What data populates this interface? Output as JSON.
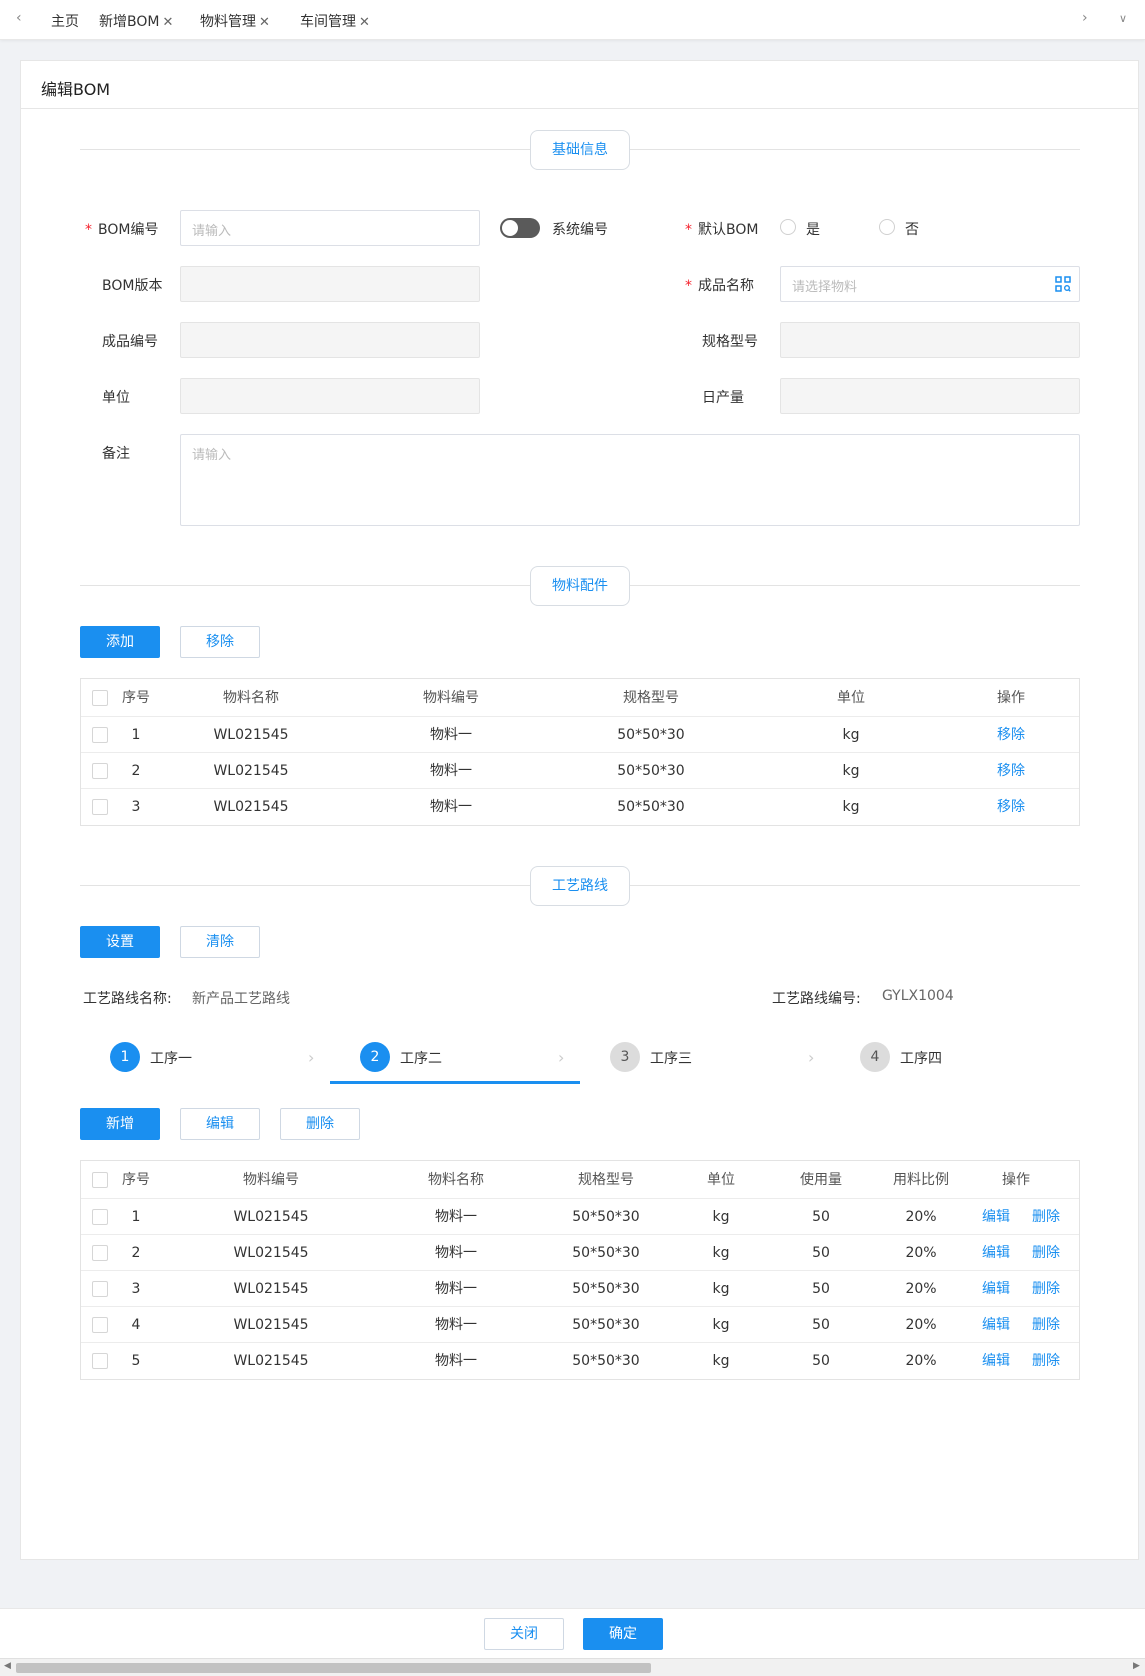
{
  "tabs": [
    {
      "label": "主页",
      "closable": false
    },
    {
      "label": "新增BOM",
      "closable": true
    },
    {
      "label": "物料管理",
      "closable": true
    },
    {
      "label": "车间管理",
      "closable": true
    }
  ],
  "tab_close_glyph": "✕",
  "nav": {
    "prev_icon": "chevron-left-icon",
    "next_icon": "chevron-right-icon",
    "more_icon": "chevron-down-icon"
  },
  "page_title": "编辑BOM",
  "sections": {
    "basic": "基础信息",
    "materials": "物料配件",
    "route": "工艺路线"
  },
  "form": {
    "required_mark": "*",
    "bom_no_label": "BOM编号",
    "bom_no_placeholder": "请输入",
    "system_no_label": "系统编号",
    "default_bom_label": "默认BOM",
    "yes_label": "是",
    "no_label": "否",
    "bom_version_label": "BOM版本",
    "product_name_label": "成品名称",
    "product_name_placeholder": "请选择物料",
    "product_no_label": "成品编号",
    "spec_label": "规格型号",
    "unit_label": "单位",
    "daily_output_label": "日产量",
    "remark_label": "备注",
    "remark_placeholder": "请输入"
  },
  "materials": {
    "add_label": "添加",
    "remove_label": "移除",
    "columns": [
      "序号",
      "物料名称",
      "物料编号",
      "规格型号",
      "单位",
      "操作"
    ],
    "rows": [
      {
        "no": "1",
        "name": "WL021545",
        "code": "物料一",
        "spec": "50*50*30",
        "unit": "kg",
        "action": "移除"
      },
      {
        "no": "2",
        "name": "WL021545",
        "code": "物料一",
        "spec": "50*50*30",
        "unit": "kg",
        "action": "移除"
      },
      {
        "no": "3",
        "name": "WL021545",
        "code": "物料一",
        "spec": "50*50*30",
        "unit": "kg",
        "action": "移除"
      }
    ]
  },
  "route": {
    "set_label": "设置",
    "clear_label": "清除",
    "name_label": "工艺路线名称:",
    "name_value": "新产品工艺路线",
    "code_label": "工艺路线编号:",
    "code_value": "GYLX1004",
    "steps": [
      {
        "num": "1",
        "label": "工序一",
        "state": "done"
      },
      {
        "num": "2",
        "label": "工序二",
        "state": "current"
      },
      {
        "num": "3",
        "label": "工序三",
        "state": "pending"
      },
      {
        "num": "4",
        "label": "工序四",
        "state": "pending"
      }
    ],
    "new_label": "新增",
    "edit_label": "编辑",
    "delete_label": "删除",
    "columns": [
      "序号",
      "物料编号",
      "物料名称",
      "规格型号",
      "单位",
      "使用量",
      "用料比例",
      "操作"
    ],
    "rows": [
      {
        "no": "1",
        "code": "WL021545",
        "name": "物料一",
        "spec": "50*50*30",
        "unit": "kg",
        "qty": "50",
        "ratio": "20%",
        "edit": "编辑",
        "del": "删除"
      },
      {
        "no": "2",
        "code": "WL021545",
        "name": "物料一",
        "spec": "50*50*30",
        "unit": "kg",
        "qty": "50",
        "ratio": "20%",
        "edit": "编辑",
        "del": "删除"
      },
      {
        "no": "3",
        "code": "WL021545",
        "name": "物料一",
        "spec": "50*50*30",
        "unit": "kg",
        "qty": "50",
        "ratio": "20%",
        "edit": "编辑",
        "del": "删除"
      },
      {
        "no": "4",
        "code": "WL021545",
        "name": "物料一",
        "spec": "50*50*30",
        "unit": "kg",
        "qty": "50",
        "ratio": "20%",
        "edit": "编辑",
        "del": "删除"
      },
      {
        "no": "5",
        "code": "WL021545",
        "name": "物料一",
        "spec": "50*50*30",
        "unit": "kg",
        "qty": "50",
        "ratio": "20%",
        "edit": "编辑",
        "del": "删除"
      }
    ]
  },
  "footer": {
    "close_label": "关闭",
    "confirm_label": "确定"
  },
  "colors": {
    "accent": "#1a8ff0",
    "required": "#f5222d"
  }
}
